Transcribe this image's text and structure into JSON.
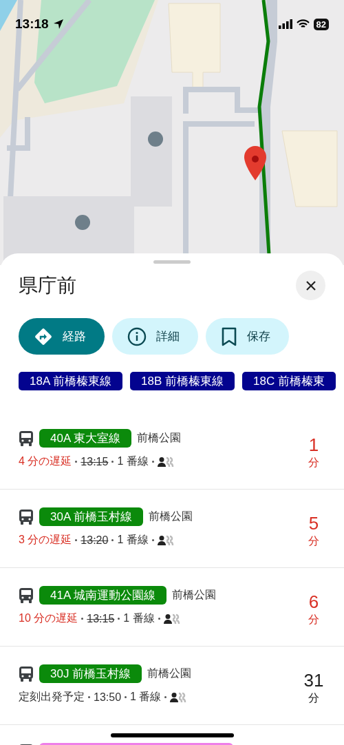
{
  "status_bar": {
    "time": "13:18",
    "battery": "82"
  },
  "sheet": {
    "title": "県庁前",
    "actions": [
      {
        "label": "経路",
        "kind": "directions",
        "selected": true
      },
      {
        "label": "詳細",
        "kind": "info",
        "selected": false
      },
      {
        "label": "保存",
        "kind": "save",
        "selected": false
      }
    ],
    "routes": [
      {
        "label": "18A 前橋榛東線",
        "color": "#03038f"
      },
      {
        "label": "18B 前橋榛東線",
        "color": "#03038f"
      },
      {
        "label": "18C 前橋榛東",
        "color": "#03038f"
      }
    ],
    "departures": [
      {
        "kind": "delayed",
        "route": "40A 東大室線",
        "color": "#0b8a0b",
        "destination": "前橋公園",
        "status": "4 分の遅延",
        "time": "13:15",
        "platform": "1 番線",
        "eta": "1",
        "eta_unit": "分"
      },
      {
        "kind": "delayed",
        "route": "30A 前橋玉村線",
        "color": "#0b8a0b",
        "destination": "前橋公園",
        "status": "3 分の遅延",
        "time": "13:20",
        "platform": "1 番線",
        "eta": "5",
        "eta_unit": "分"
      },
      {
        "kind": "delayed",
        "route": "41A 城南運動公園線",
        "color": "#0b8a0b",
        "destination": "前橋公園",
        "status": "10 分の遅延",
        "time": "13:15",
        "platform": "1 番線",
        "eta": "6",
        "eta_unit": "分"
      },
      {
        "kind": "scheduled",
        "route": "30J 前橋玉村線",
        "color": "#0b8a0b",
        "destination": "前橋公園",
        "status": "定刻出発予定",
        "time": "13:50",
        "platform": "1 番線",
        "eta": "31",
        "eta_unit": "分"
      },
      {
        "kind": "cut",
        "color": "#ee7fe9"
      }
    ]
  }
}
